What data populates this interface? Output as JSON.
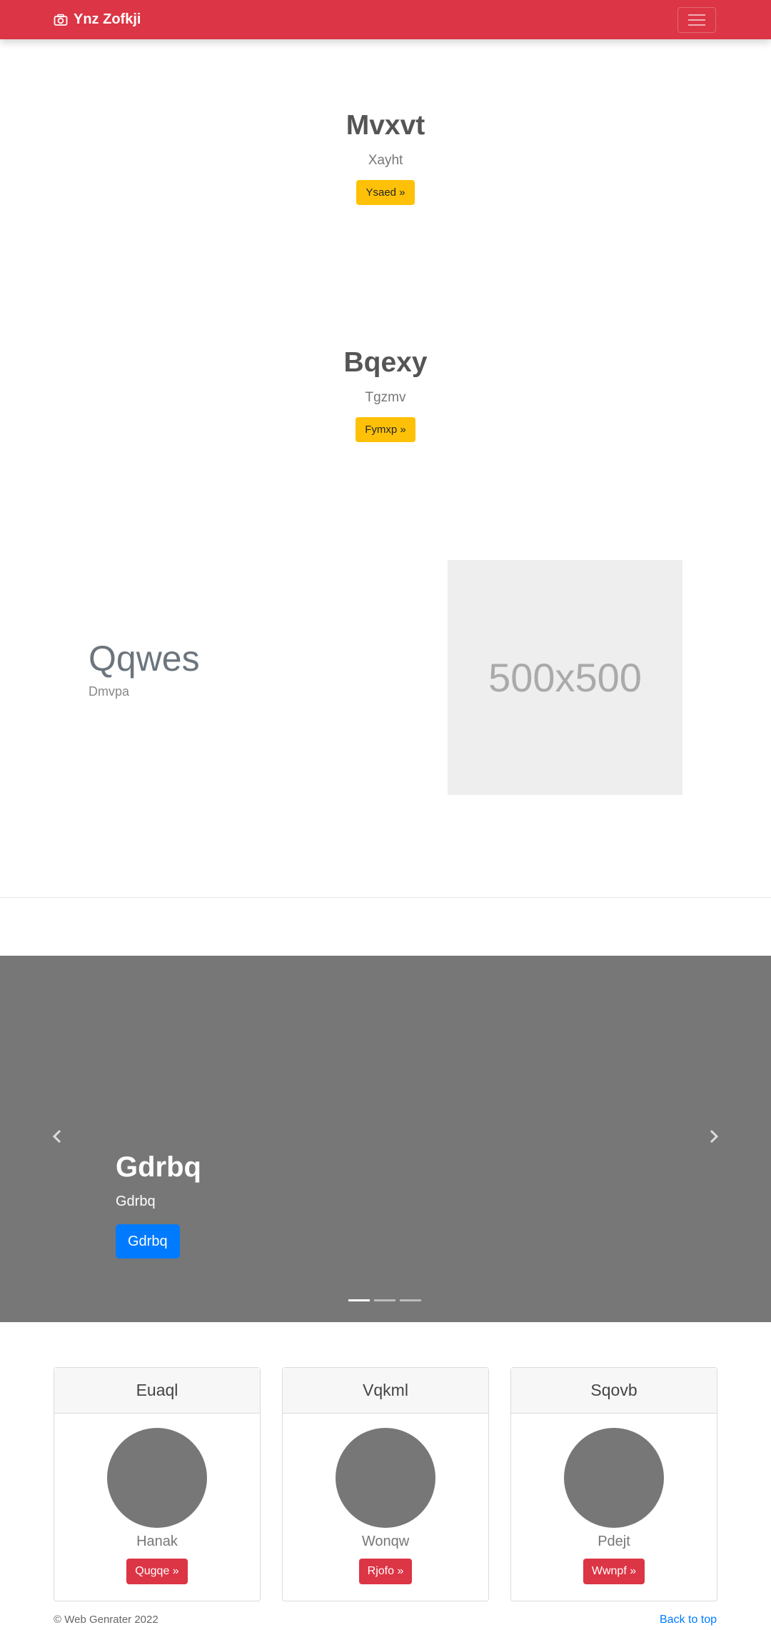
{
  "navbar": {
    "brand": "Ynz Zofkji",
    "brand_color": "#dc3545",
    "icon": "camera-icon",
    "toggle_icon": "hamburger-menu-icon"
  },
  "hero1": {
    "title": "Mvxvt",
    "subtitle": "Xayht",
    "button": "Ysaed »"
  },
  "hero2": {
    "title": "Bqexy",
    "subtitle": "Tgzmv",
    "button": "Fymxp »"
  },
  "feature": {
    "title": "Qqwes",
    "subtitle": "Dmvpa",
    "image_label": "500x500"
  },
  "carousel": {
    "title": "Gdrbq",
    "text": "Gdrbq",
    "button": "Gdrbq",
    "slides": 3,
    "active_slide": 1,
    "prev_icon": "chevron-left-icon",
    "next_icon": "chevron-right-icon"
  },
  "cards": [
    {
      "header": "Euaql",
      "name": "Hanak",
      "button": "Qugqe »"
    },
    {
      "header": "Vqkml",
      "name": "Wonqw",
      "button": "Rjofo »"
    },
    {
      "header": "Sqovb",
      "name": "Pdejt",
      "button": "Wwnpf »"
    }
  ],
  "footer": {
    "copyright": "© Web Genrater 2022",
    "back_to_top": "Back to top"
  }
}
